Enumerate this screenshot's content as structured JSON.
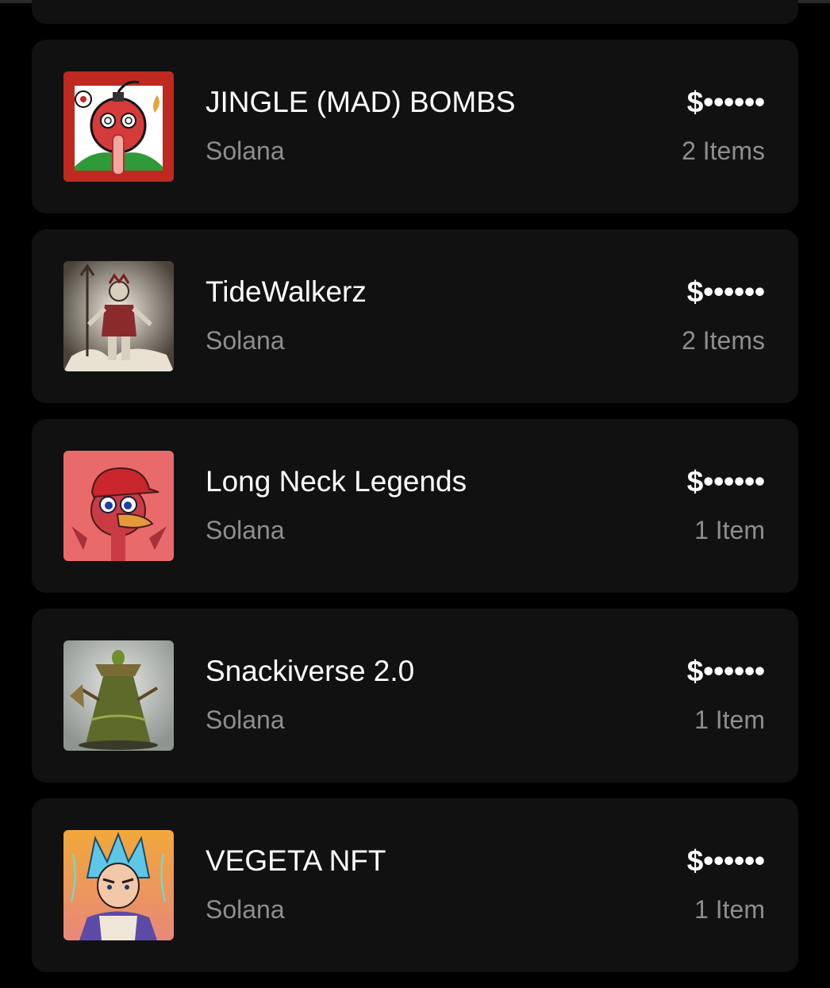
{
  "collections": [
    {
      "name": "JINGLE (MAD) BOMBS",
      "chain": "Solana",
      "value": "$••••••",
      "count": "2 Items",
      "thumb_icon": "red-bomb-character-icon"
    },
    {
      "name": "TideWalkerz",
      "chain": "Solana",
      "value": "$••••••",
      "count": "2 Items",
      "thumb_icon": "warrior-with-trident-icon"
    },
    {
      "name": "Long Neck Legends",
      "chain": "Solana",
      "value": "$••••••",
      "count": "1 Item",
      "thumb_icon": "red-duck-with-cap-icon"
    },
    {
      "name": "Snackiverse 2.0",
      "chain": "Solana",
      "value": "$••••••",
      "count": "1 Item",
      "thumb_icon": "vegetable-creature-icon"
    },
    {
      "name": "VEGETA NFT",
      "chain": "Solana",
      "value": "$••••••",
      "count": "1 Item",
      "thumb_icon": "anime-character-icon"
    }
  ],
  "colors": {
    "background": "#000000",
    "card": "#111111",
    "primary_text": "#ffffff",
    "secondary_text": "#8e8e8e"
  }
}
